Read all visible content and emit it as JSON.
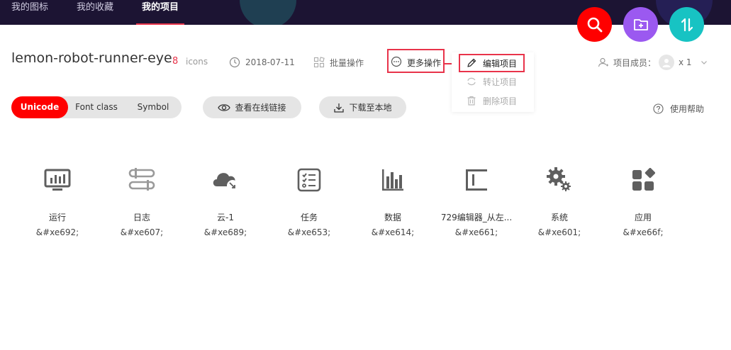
{
  "nav": {
    "items": [
      {
        "label": "我的图标"
      },
      {
        "label": "我的收藏"
      },
      {
        "label": "我的项目"
      }
    ]
  },
  "project": {
    "name": "lemon-robot-runner-eye",
    "icon_count": "8",
    "icon_word": "icons",
    "date": "2018-07-11",
    "batch_label": "批量操作",
    "more_label": "更多操作",
    "members_label": "项目成员：",
    "members_count": "x 1"
  },
  "dropdown": {
    "edit": "编辑项目",
    "transfer": "转让项目",
    "delete": "删除项目"
  },
  "tabs": {
    "unicode": "Unicode",
    "font_class": "Font class",
    "symbol": "Symbol"
  },
  "actions": {
    "view_link": "查看在线链接",
    "download": "下载至本地",
    "help": "使用帮助"
  },
  "icons": [
    {
      "name": "运行",
      "code": "&#xe692;",
      "icon": "monitor-chart-icon"
    },
    {
      "name": "日志",
      "code": "&#xe607;",
      "icon": "log-sliders-icon"
    },
    {
      "name": "云-1",
      "code": "&#xe689;",
      "icon": "cloud-icon"
    },
    {
      "name": "任务",
      "code": "&#xe653;",
      "icon": "checklist-icon"
    },
    {
      "name": "数据",
      "code": "&#xe614;",
      "icon": "bar-chart-icon"
    },
    {
      "name": "729编辑器_从左...",
      "code": "&#xe661;",
      "icon": "align-left-icon"
    },
    {
      "name": "系统",
      "code": "&#xe601;",
      "icon": "gears-icon"
    },
    {
      "name": "应用",
      "code": "&#xe66f;",
      "icon": "apps-icon"
    }
  ],
  "colors": {
    "nav_bg": "#1c1433",
    "accent_red": "#e8334a",
    "search_fab": "#ff0000",
    "folder_fab": "#9b59f0",
    "sort_fab": "#17c3c3"
  }
}
